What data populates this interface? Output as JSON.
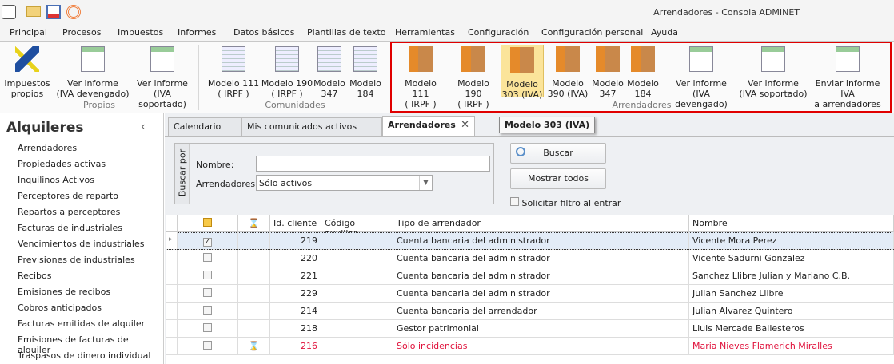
{
  "window": {
    "title": "Arrendadores - Consola ADMINET"
  },
  "quick_access": [
    "app-icon",
    "mail-icon",
    "clipboard-icon",
    "broadcast-icon"
  ],
  "menu_tabs": [
    "Principal",
    "Procesos",
    "Impuestos",
    "Informes",
    "Datos básicos",
    "Plantillas de texto",
    "Herramientas",
    "Configuración",
    "Configuración personal",
    "Ayuda"
  ],
  "ribbon": {
    "groups": [
      {
        "label": "Propios",
        "buttons": [
          [
            "Impuestos",
            "propios"
          ],
          [
            "Ver informe",
            "(IVA devengado)"
          ],
          [
            "Ver informe",
            "(IVA soportado)"
          ]
        ]
      },
      {
        "label": "Comunidades",
        "buttons": [
          [
            "Modelo 111",
            "( IRPF )"
          ],
          [
            "Modelo 190",
            "( IRPF )"
          ],
          [
            "Modelo",
            "347"
          ],
          [
            "Modelo",
            "184"
          ]
        ]
      },
      {
        "label": "Arrendadores",
        "buttons": [
          [
            "Modelo 111",
            "( IRPF )"
          ],
          [
            "Modelo 190",
            "( IRPF )"
          ],
          [
            "Modelo",
            "303 (IVA)"
          ],
          [
            "Modelo",
            "390 (IVA)"
          ],
          [
            "Modelo",
            "347"
          ],
          [
            "Modelo",
            "184"
          ],
          [
            "Ver informe",
            "(IVA devengado)"
          ],
          [
            "Ver informe",
            "(IVA soportado)"
          ],
          [
            "Enviar informe IVA",
            "a arrendadores"
          ]
        ]
      }
    ]
  },
  "tooltip": "Modelo 303 (IVA)",
  "sidebar": {
    "title": "Alquileres",
    "collapse": "‹",
    "items": [
      "Arrendadores",
      "Propiedades activas",
      "Inquilinos Activos",
      "Perceptores de reparto",
      "Repartos a perceptores",
      "Facturas de industriales",
      "Vencimientos de industriales",
      "Previsiones de industriales",
      "Recibos",
      "Emisiones de recibos",
      "Cobros anticipados",
      "Facturas emitidas de alquiler",
      "Emisiones de facturas de alquiler",
      "Traspasos de dinero individual"
    ]
  },
  "doc_tabs": [
    "Calendario",
    "Mis comunicados activos",
    "Arrendadores"
  ],
  "search": {
    "group_label": "Buscar por",
    "nombre_label": "Nombre:",
    "nombre_value": "",
    "arr_label": "Arrendadores:",
    "arr_value": "Sólo activos",
    "buscar": "Buscar",
    "mostrar": "Mostrar todos",
    "solicitar": "Solicitar filtro al entrar"
  },
  "grid": {
    "headers": [
      "Id. cliente",
      "Código auxiliar",
      "Tipo de arrendador",
      "Nombre"
    ],
    "rows": [
      {
        "id": "219",
        "codigo": "",
        "tipo": "Cuenta bancaria del administrador",
        "nombre": "Vicente Mora Perez",
        "checked": true,
        "alert": false
      },
      {
        "id": "220",
        "codigo": "",
        "tipo": "Cuenta bancaria del administrador",
        "nombre": "Vicente Sadurni Gonzalez",
        "checked": false,
        "alert": false
      },
      {
        "id": "221",
        "codigo": "",
        "tipo": "Cuenta bancaria del administrador",
        "nombre": "Sanchez Llibre Julian y Mariano C.B.",
        "checked": false,
        "alert": false
      },
      {
        "id": "229",
        "codigo": "",
        "tipo": "Cuenta bancaria del administrador",
        "nombre": "Julian Sanchez Llibre",
        "checked": false,
        "alert": false
      },
      {
        "id": "214",
        "codigo": "",
        "tipo": "Cuenta bancaria del arrendador",
        "nombre": "Julian Alvarez Quintero",
        "checked": false,
        "alert": false
      },
      {
        "id": "218",
        "codigo": "",
        "tipo": "Gestor patrimonial",
        "nombre": "Lluis Mercade Ballesteros",
        "checked": false,
        "alert": false
      },
      {
        "id": "216",
        "codigo": "",
        "tipo": "Sólo incidencias",
        "nombre": "Maria Nieves Flamerich Miralles",
        "checked": false,
        "alert": true
      }
    ]
  },
  "colors": {
    "highlight": "#e00000",
    "alert_text": "#e0103a",
    "selected_row": "#e3ecf7"
  }
}
